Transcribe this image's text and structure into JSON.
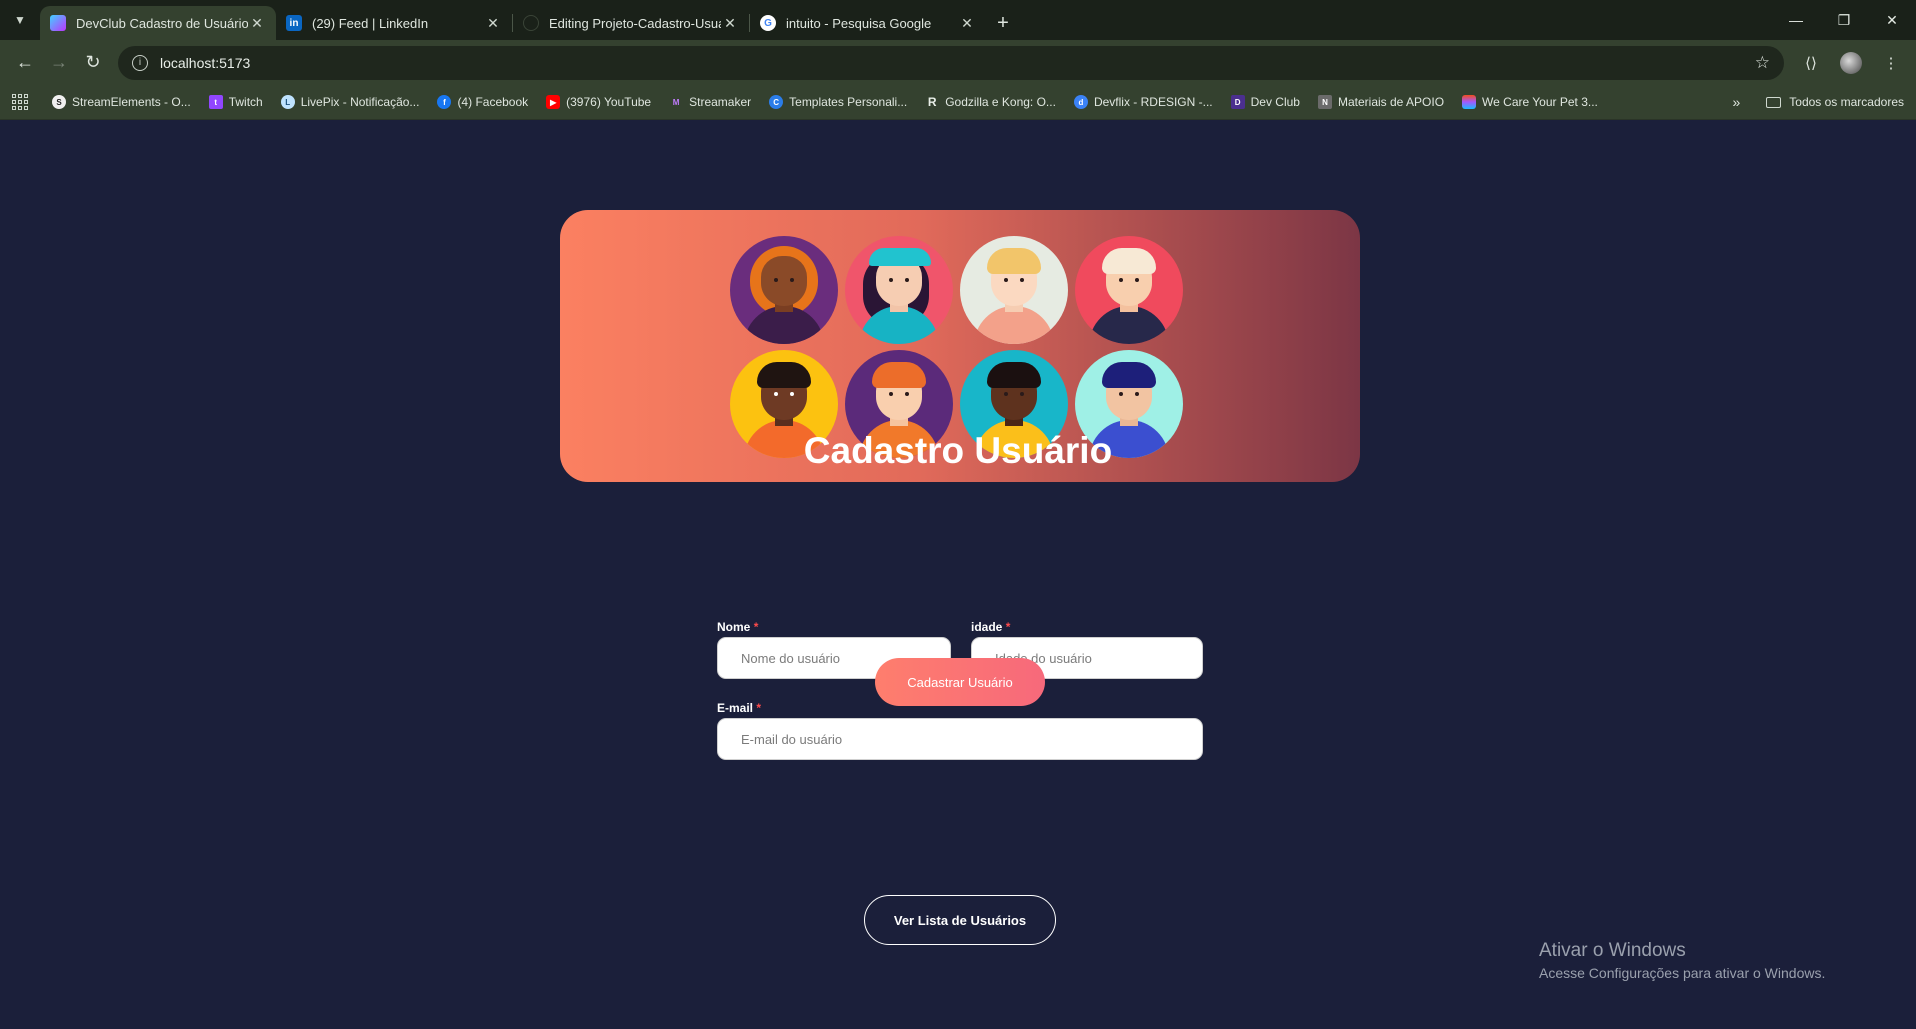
{
  "browser": {
    "tabs": [
      {
        "label": "DevClub Cadastro de Usuário",
        "favicon": "vite-icon",
        "active": true
      },
      {
        "label": "(29) Feed | LinkedIn",
        "favicon": "linkedin-icon",
        "active": false
      },
      {
        "label": "Editing Projeto-Cadastro-Usuar",
        "favicon": "github-icon",
        "active": false
      },
      {
        "label": "intuito - Pesquisa Google",
        "favicon": "google-icon",
        "active": false
      }
    ],
    "address": "localhost:5173",
    "bookmarks": [
      "StreamElements - O...",
      "Twitch",
      "LivePix - Notificação...",
      "(4) Facebook",
      "(3976) YouTube",
      "Streamaker",
      "Templates Personali...",
      "Godzilla e Kong: O...",
      "Devflix - RDESIGN -...",
      "Dev Club",
      "Materiais de APOIO",
      "We Care Your Pet 3..."
    ],
    "all_bookmarks": "Todos os marcadores"
  },
  "page": {
    "title": "Cadastro Usuário",
    "form": {
      "name_label": "Nome",
      "name_placeholder": "Nome do usuário",
      "age_label": "idade",
      "age_placeholder": "Idade do  usuário",
      "email_label": "E-mail",
      "email_placeholder": "E-mail do usuário",
      "required_mark": "*"
    },
    "submit_label": "Cadastrar Usuário",
    "list_label": "Ver Lista de Usuários"
  },
  "watermark": {
    "line1": "Ativar o Windows",
    "line2": "Acesse Configurações para ativar o Windows."
  },
  "colors": {
    "page_bg": "#1b1f3a",
    "accent": "#fe7e6d",
    "hero_gradient_start": "#fb8061",
    "hero_gradient_end": "#7c3645"
  }
}
